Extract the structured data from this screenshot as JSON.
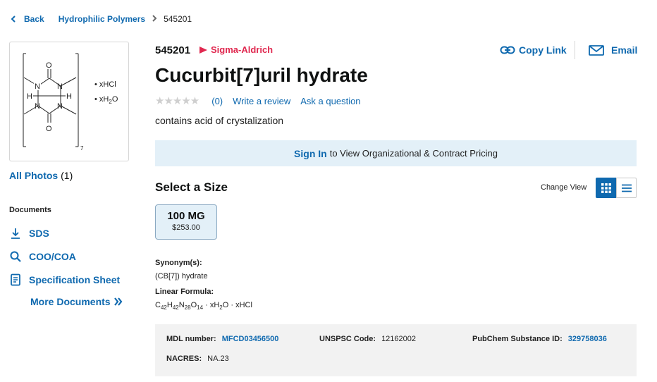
{
  "breadcrumb": {
    "back_label": "Back",
    "category": "Hydrophilic Polymers",
    "current": "545201"
  },
  "structure": {
    "salt_label": "xHCl",
    "water_label": "xH",
    "water_sub": "2",
    "water_end": "O",
    "repeat_n": "7"
  },
  "photos": {
    "label": "All Photos",
    "count": "(1)"
  },
  "documents": {
    "heading": "Documents",
    "sds": "SDS",
    "coo": "COO/COA",
    "spec": "Specification Sheet",
    "more": "More Documents"
  },
  "product": {
    "number": "545201",
    "brand": "Sigma-Aldrich",
    "title": "Cucurbit[7]uril hydrate",
    "review_count": "(0)",
    "write_review": "Write a review",
    "ask_question": "Ask a question",
    "description": "contains acid of crystalization",
    "rating": 0
  },
  "actions": {
    "copy_link": "Copy Link",
    "email": "Email"
  },
  "signin": {
    "link": "Sign In",
    "text": "to View Organizational & Contract Pricing"
  },
  "sizes": {
    "heading": "Select a Size",
    "change_view": "Change View",
    "items": [
      {
        "size": "100 MG",
        "price": "$253.00"
      }
    ]
  },
  "synonyms": {
    "label": "Synonym(s):",
    "value": "(CB[7]) hydrate"
  },
  "formula": {
    "label": "Linear Formula:",
    "parts": [
      "C",
      "42",
      "H",
      "42",
      "N",
      "28",
      "O",
      "14",
      " · xH",
      "2",
      "O · xHCl"
    ]
  },
  "properties": {
    "mdl_label": "MDL number:",
    "mdl_value": "MFCD03456500",
    "unspsc_label": "UNSPSC Code:",
    "unspsc_value": "12162002",
    "pubchem_label": "PubChem Substance ID:",
    "pubchem_value": "329758036",
    "nacres_label": "NACRES:",
    "nacres_value": "NA.23"
  },
  "colors": {
    "link": "#0f69af",
    "brand": "#e0284f",
    "banner": "#e3f0f8"
  }
}
